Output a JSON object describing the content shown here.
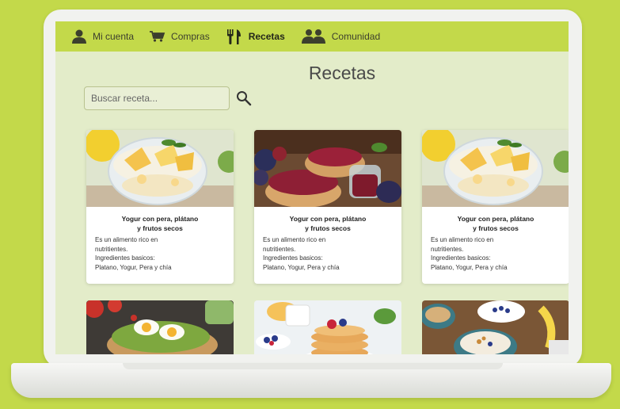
{
  "nav": {
    "items": [
      {
        "label": "Mi cuenta",
        "icon": "user-icon"
      },
      {
        "label": "Compras",
        "icon": "cart-icon"
      },
      {
        "label": "Recetas",
        "icon": "cutlery-icon"
      },
      {
        "label": "Comunidad",
        "icon": "community-icon"
      }
    ]
  },
  "page": {
    "title": "Recetas"
  },
  "search": {
    "placeholder": "Buscar receta..."
  },
  "cards": [
    {
      "title_line1": "Yogur con pera, plátano",
      "title_line2": "y frutos secos",
      "desc": [
        "Es un alimento rico en",
        "nutritientes.",
        "Ingredientes basicos:",
        "Platano, Yogur, Pera y chía"
      ],
      "image": "yogurt-parfait-photo"
    },
    {
      "title_line1": "Yogur con pera, plátano",
      "title_line2": "y frutos secos",
      "desc": [
        "Es un alimento rico en",
        "nutritientes.",
        "Ingredientes basicos:",
        "Platano, Yogur, Pera y chía"
      ],
      "image": "jam-toast-photo"
    },
    {
      "title_line1": "Yogur con pera, plátano",
      "title_line2": "y frutos secos",
      "desc": [
        "Es un alimento rico en",
        "nutritientes.",
        "Ingredientes basicos:",
        "Platano, Yogur, Pera y chía"
      ],
      "image": "yogurt-parfait-photo"
    }
  ],
  "second_row_images": [
    "avocado-egg-toast-photo",
    "pancakes-photo",
    "granola-bowl-photo"
  ],
  "colors": {
    "background": "#c3d94a",
    "navbar": "#c3d94a",
    "screen": "#e3ecc9"
  }
}
